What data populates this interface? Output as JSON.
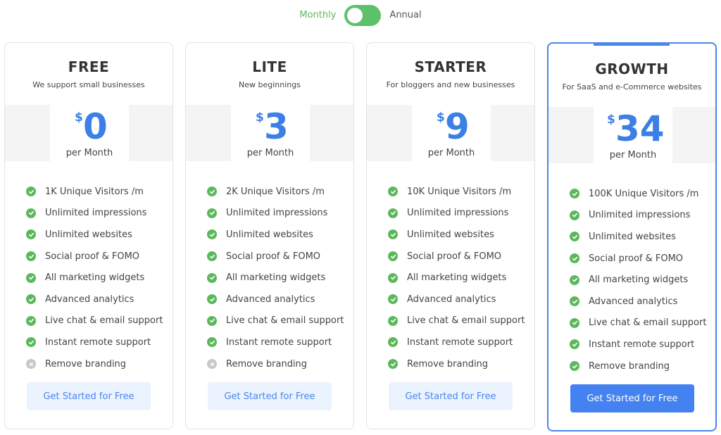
{
  "billing_toggle": {
    "left_label": "Monthly",
    "right_label": "Annual",
    "state": "Monthly"
  },
  "colors": {
    "accent_blue": "#4b86ee",
    "price_blue": "#3c7fe6",
    "check_green": "#5cb85c",
    "toggle_green": "#5cc26a",
    "disabled_gray": "#c8c8c8"
  },
  "plans": [
    {
      "name": "FREE",
      "description": "We support small businesses",
      "currency": "$",
      "price": "0",
      "period": "per Month",
      "featured": false,
      "features": [
        {
          "label": "1K Unique Visitors /m",
          "included": true,
          "icon": "check-circle-icon"
        },
        {
          "label": "Unlimited impressions",
          "included": true,
          "icon": "check-circle-icon"
        },
        {
          "label": "Unlimited websites",
          "included": true,
          "icon": "check-circle-icon"
        },
        {
          "label": "Social proof & FOMO",
          "included": true,
          "icon": "check-circle-icon"
        },
        {
          "label": "All marketing widgets",
          "included": true,
          "icon": "check-circle-icon"
        },
        {
          "label": "Advanced analytics",
          "included": true,
          "icon": "check-circle-icon"
        },
        {
          "label": "Live chat & email support",
          "included": true,
          "icon": "check-circle-icon"
        },
        {
          "label": "Instant remote support",
          "included": true,
          "icon": "check-circle-icon"
        },
        {
          "label": "Remove branding",
          "included": false,
          "icon": "x-circle-icon"
        }
      ],
      "cta": "Get Started for Free"
    },
    {
      "name": "LITE",
      "description": "New beginnings",
      "currency": "$",
      "price": "3",
      "period": "per Month",
      "featured": false,
      "features": [
        {
          "label": "2K Unique Visitors /m",
          "included": true,
          "icon": "check-circle-icon"
        },
        {
          "label": "Unlimited impressions",
          "included": true,
          "icon": "check-circle-icon"
        },
        {
          "label": "Unlimited websites",
          "included": true,
          "icon": "check-circle-icon"
        },
        {
          "label": "Social proof & FOMO",
          "included": true,
          "icon": "check-circle-icon"
        },
        {
          "label": "All marketing widgets",
          "included": true,
          "icon": "check-circle-icon"
        },
        {
          "label": "Advanced analytics",
          "included": true,
          "icon": "check-circle-icon"
        },
        {
          "label": "Live chat & email support",
          "included": true,
          "icon": "check-circle-icon"
        },
        {
          "label": "Instant remote support",
          "included": true,
          "icon": "check-circle-icon"
        },
        {
          "label": "Remove branding",
          "included": false,
          "icon": "x-circle-icon"
        }
      ],
      "cta": "Get Started for Free"
    },
    {
      "name": "STARTER",
      "description": "For bloggers and new businesses",
      "currency": "$",
      "price": "9",
      "period": "per Month",
      "featured": false,
      "features": [
        {
          "label": "10K Unique Visitors /m",
          "included": true,
          "icon": "check-circle-icon"
        },
        {
          "label": "Unlimited impressions",
          "included": true,
          "icon": "check-circle-icon"
        },
        {
          "label": "Unlimited websites",
          "included": true,
          "icon": "check-circle-icon"
        },
        {
          "label": "Social proof & FOMO",
          "included": true,
          "icon": "check-circle-icon"
        },
        {
          "label": "All marketing widgets",
          "included": true,
          "icon": "check-circle-icon"
        },
        {
          "label": "Advanced analytics",
          "included": true,
          "icon": "check-circle-icon"
        },
        {
          "label": "Live chat & email support",
          "included": true,
          "icon": "check-circle-icon"
        },
        {
          "label": "Instant remote support",
          "included": true,
          "icon": "check-circle-icon"
        },
        {
          "label": "Remove branding",
          "included": true,
          "icon": "check-circle-icon"
        }
      ],
      "cta": "Get Started for Free"
    },
    {
      "name": "GROWTH",
      "description": "For SaaS and e-Commerce websites",
      "currency": "$",
      "price": "34",
      "period": "per Month",
      "featured": true,
      "features": [
        {
          "label": "100K Unique Visitors /m",
          "included": true,
          "icon": "check-circle-icon"
        },
        {
          "label": "Unlimited impressions",
          "included": true,
          "icon": "check-circle-icon"
        },
        {
          "label": "Unlimited websites",
          "included": true,
          "icon": "check-circle-icon"
        },
        {
          "label": "Social proof & FOMO",
          "included": true,
          "icon": "check-circle-icon"
        },
        {
          "label": "All marketing widgets",
          "included": true,
          "icon": "check-circle-icon"
        },
        {
          "label": "Advanced analytics",
          "included": true,
          "icon": "check-circle-icon"
        },
        {
          "label": "Live chat & email support",
          "included": true,
          "icon": "check-circle-icon"
        },
        {
          "label": "Instant remote support",
          "included": true,
          "icon": "check-circle-icon"
        },
        {
          "label": "Remove branding",
          "included": true,
          "icon": "check-circle-icon"
        }
      ],
      "cta": "Get Started for Free"
    }
  ]
}
